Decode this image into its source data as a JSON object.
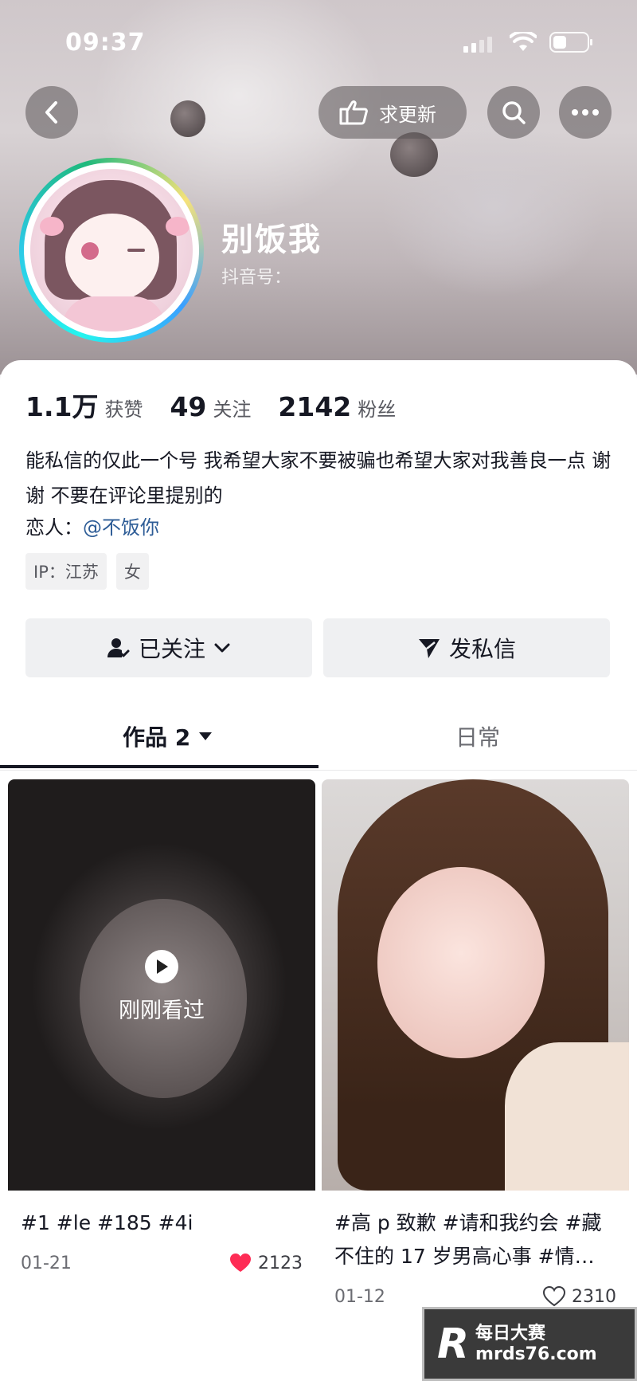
{
  "status_bar": {
    "time": "09:37"
  },
  "top_nav": {
    "request_update_label": "求更新"
  },
  "profile": {
    "name": "别饭我",
    "douyin_id_label": "抖音号：",
    "stats": [
      {
        "value": "1.1万",
        "label": "获赞"
      },
      {
        "value": "49",
        "label": "关注"
      },
      {
        "value": "2142",
        "label": "粉丝"
      }
    ],
    "bio": "能私信的仅此一个号 我希望大家不要被骗也希望大家对我善良一点 谢谢 不要在评论里提别的",
    "lover_label": "恋人：",
    "lover_mention": "@不饭你",
    "tags": [
      "IP：江苏",
      "女"
    ]
  },
  "actions": {
    "follow_label": "已关注",
    "message_label": "发私信"
  },
  "tabs": {
    "works_label": "作品 2",
    "daily_label": "日常"
  },
  "posts": [
    {
      "title": "#1 #le #185 #4i",
      "date": "01-21",
      "likes": "2123",
      "overlay": "刚刚看过",
      "liked": true
    },
    {
      "title": "#高 p 致歉 #请和我约会 #藏不住的 17 岁男高心事 #情…",
      "date": "01-12",
      "likes": "2310",
      "liked": false
    }
  ],
  "watermark": {
    "logo": "R",
    "line1": "每日大赛",
    "line2": "mrds76.com"
  },
  "colors": {
    "like_red": "#fe2c55",
    "mention_blue": "#2d5c96",
    "text_primary": "#161823"
  }
}
